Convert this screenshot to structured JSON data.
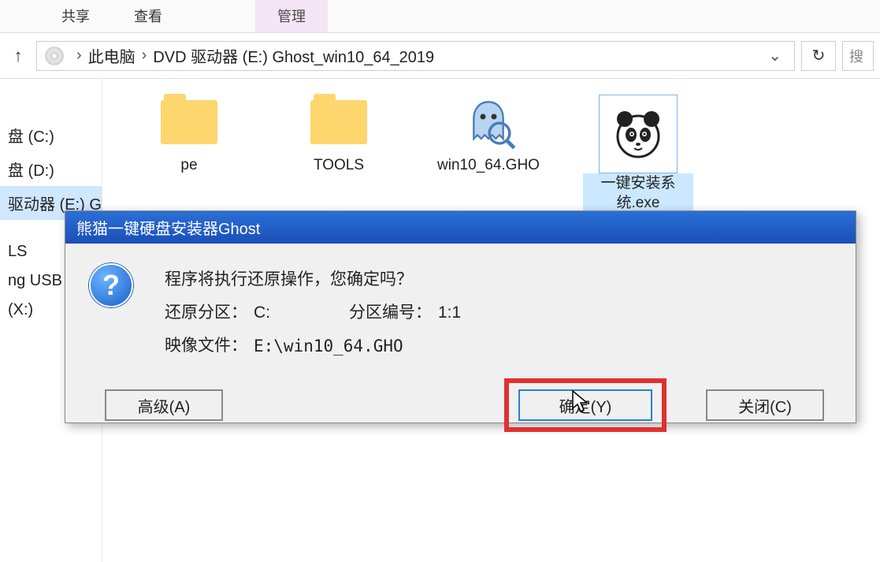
{
  "ribbon": {
    "tabs": [
      "共享",
      "查看",
      "管理"
    ]
  },
  "breadcrumb": {
    "root": "此电脑",
    "path": "DVD 驱动器 (E:) Ghost_win10_64_2019"
  },
  "search": {
    "placeholder": "搜"
  },
  "nav": {
    "items": [
      "盘 (C:)",
      "盘 (D:)",
      "驱动器 (E:) Gh",
      "",
      "LS",
      "ng USB",
      "(X:)"
    ]
  },
  "files": {
    "items": [
      {
        "name": "pe",
        "type": "folder"
      },
      {
        "name": "TOOLS",
        "type": "folder"
      },
      {
        "name": "win10_64.GHO",
        "type": "ghost"
      },
      {
        "name": "一键安装系统.exe",
        "type": "panda"
      }
    ]
  },
  "dialog": {
    "title": "熊猫一键硬盘安装器Ghost",
    "message": "程序将执行还原操作，您确定吗？",
    "partition_label": "还原分区：",
    "partition_value": "C:",
    "partnum_label": "分区编号：",
    "partnum_value": "1:1",
    "image_label": "映像文件：",
    "image_value": "E:\\win10_64.GHO",
    "advanced_label": "高级(A)",
    "confirm_label": "确定(Y)",
    "close_label": "关闭(C)"
  }
}
